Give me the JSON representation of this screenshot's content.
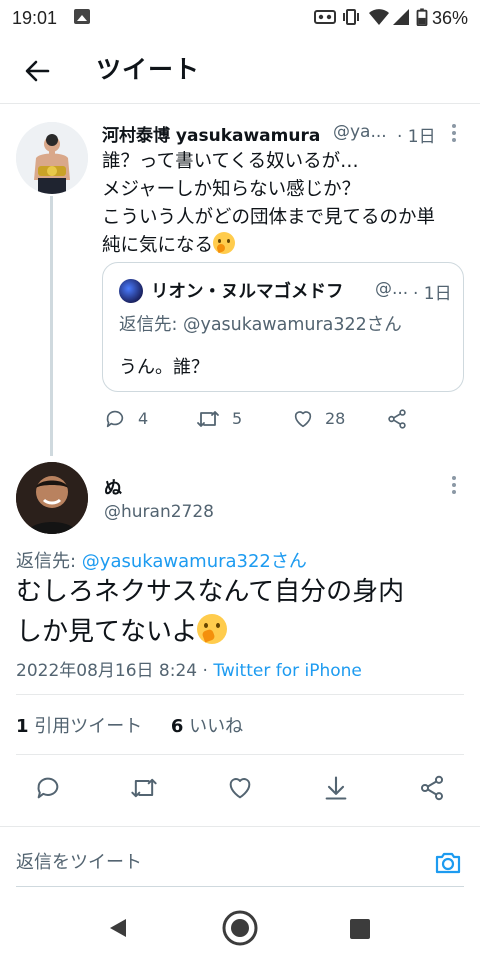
{
  "status_bar": {
    "time": "19:01",
    "battery": "36%",
    "icons": [
      "gallery-icon",
      "voicemail-icon",
      "vibrate-icon",
      "wifi-icon",
      "signal-icon",
      "battery-icon"
    ]
  },
  "header": {
    "title": "ツイート",
    "back_icon": "arrow-left-icon"
  },
  "parent_tweet": {
    "name": "河村泰博 yasukawamura",
    "handle": "@ya...",
    "time": "· 1日",
    "lines": [
      "誰？って書いてくる奴いるが…",
      "メジャーしか知らない感じか？",
      "こういう人がどの団体まで見てるのか単",
      "純に気になる"
    ],
    "emoji": "thinking-face",
    "quote": {
      "name": "リオン・ヌルマゴメドフ",
      "handle": "@...",
      "time": "· 1日",
      "reply_to": "返信先: @yasukawamura322さん",
      "text": "うん。誰？"
    },
    "actions": {
      "replies": "4",
      "retweets": "5",
      "likes": "28"
    }
  },
  "main_tweet": {
    "name": "ぬ",
    "handle": "@huran2728",
    "reply_prefix": "返信先: ",
    "reply_handle": "@yasukawamura322さん",
    "text_line1": "むしろネクサスなんて自分の身内",
    "text_line2": "しか見てないよ",
    "timestamp": "2022年08月16日 8:24 · ",
    "source": "Twitter for iPhone",
    "quote_count": "1",
    "quote_label": " 引用ツイート",
    "like_count": "6",
    "like_label": " いいね"
  },
  "reply_composer": {
    "placeholder": "返信をツイート"
  },
  "colors": {
    "accent": "#1d9bf0",
    "secondary_text": "#536471",
    "divider": "#e7e9ea"
  }
}
